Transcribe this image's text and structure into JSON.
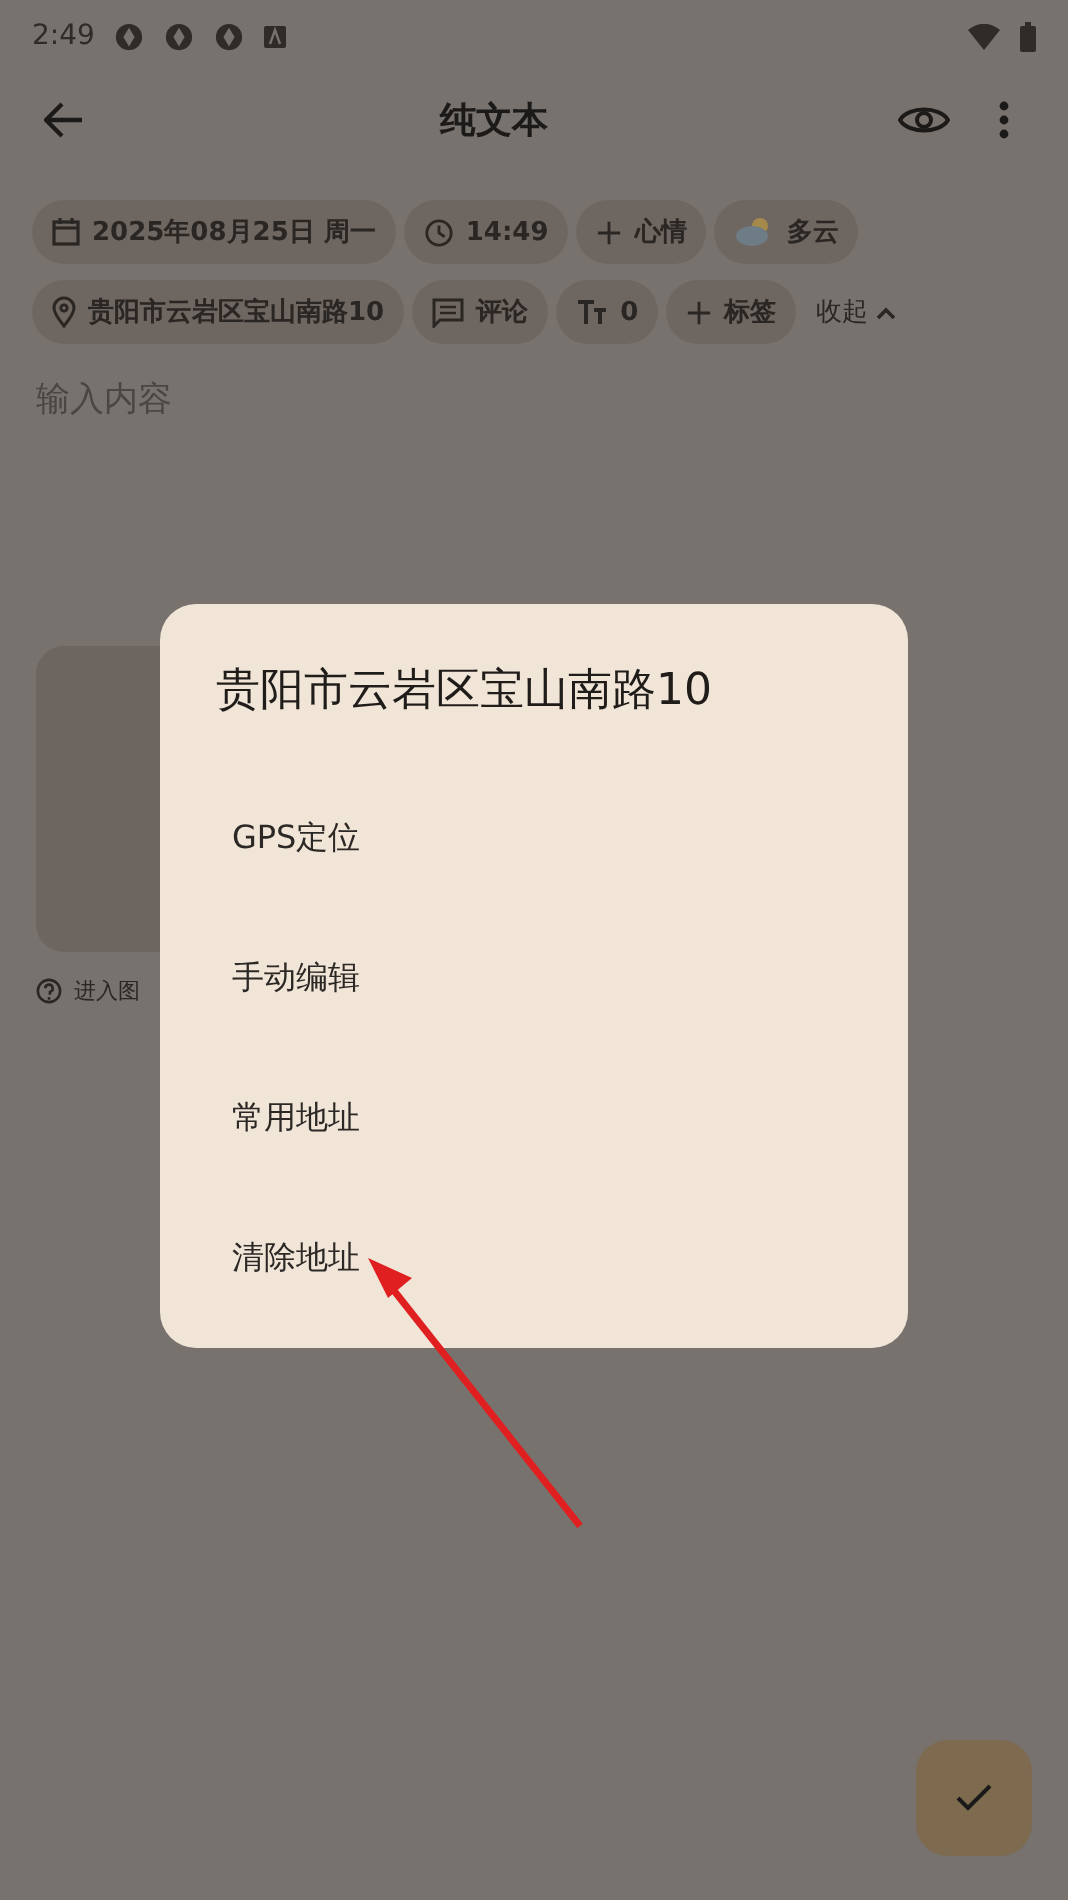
{
  "status_bar": {
    "time": "2:49"
  },
  "toolbar": {
    "title": "纯文本"
  },
  "chips": [
    {
      "kind": "calendar",
      "label": "2025年08月25日 周一"
    },
    {
      "kind": "clock",
      "label": "14:49"
    },
    {
      "kind": "plus",
      "label": "心情"
    },
    {
      "kind": "weather",
      "label": "多云"
    },
    {
      "kind": "pin",
      "label": "贵阳市云岩区宝山南路10"
    },
    {
      "kind": "comment",
      "label": "评论"
    },
    {
      "kind": "textsize",
      "label": "0"
    },
    {
      "kind": "plus",
      "label": "标签"
    }
  ],
  "collapse": {
    "label": "收起"
  },
  "editor": {
    "placeholder": "输入内容"
  },
  "gallery_hint": "进入图",
  "dialog": {
    "title": "贵阳市云岩区宝山南路10",
    "options": [
      "GPS定位",
      "手动编辑",
      "常用地址",
      "清除地址"
    ]
  }
}
